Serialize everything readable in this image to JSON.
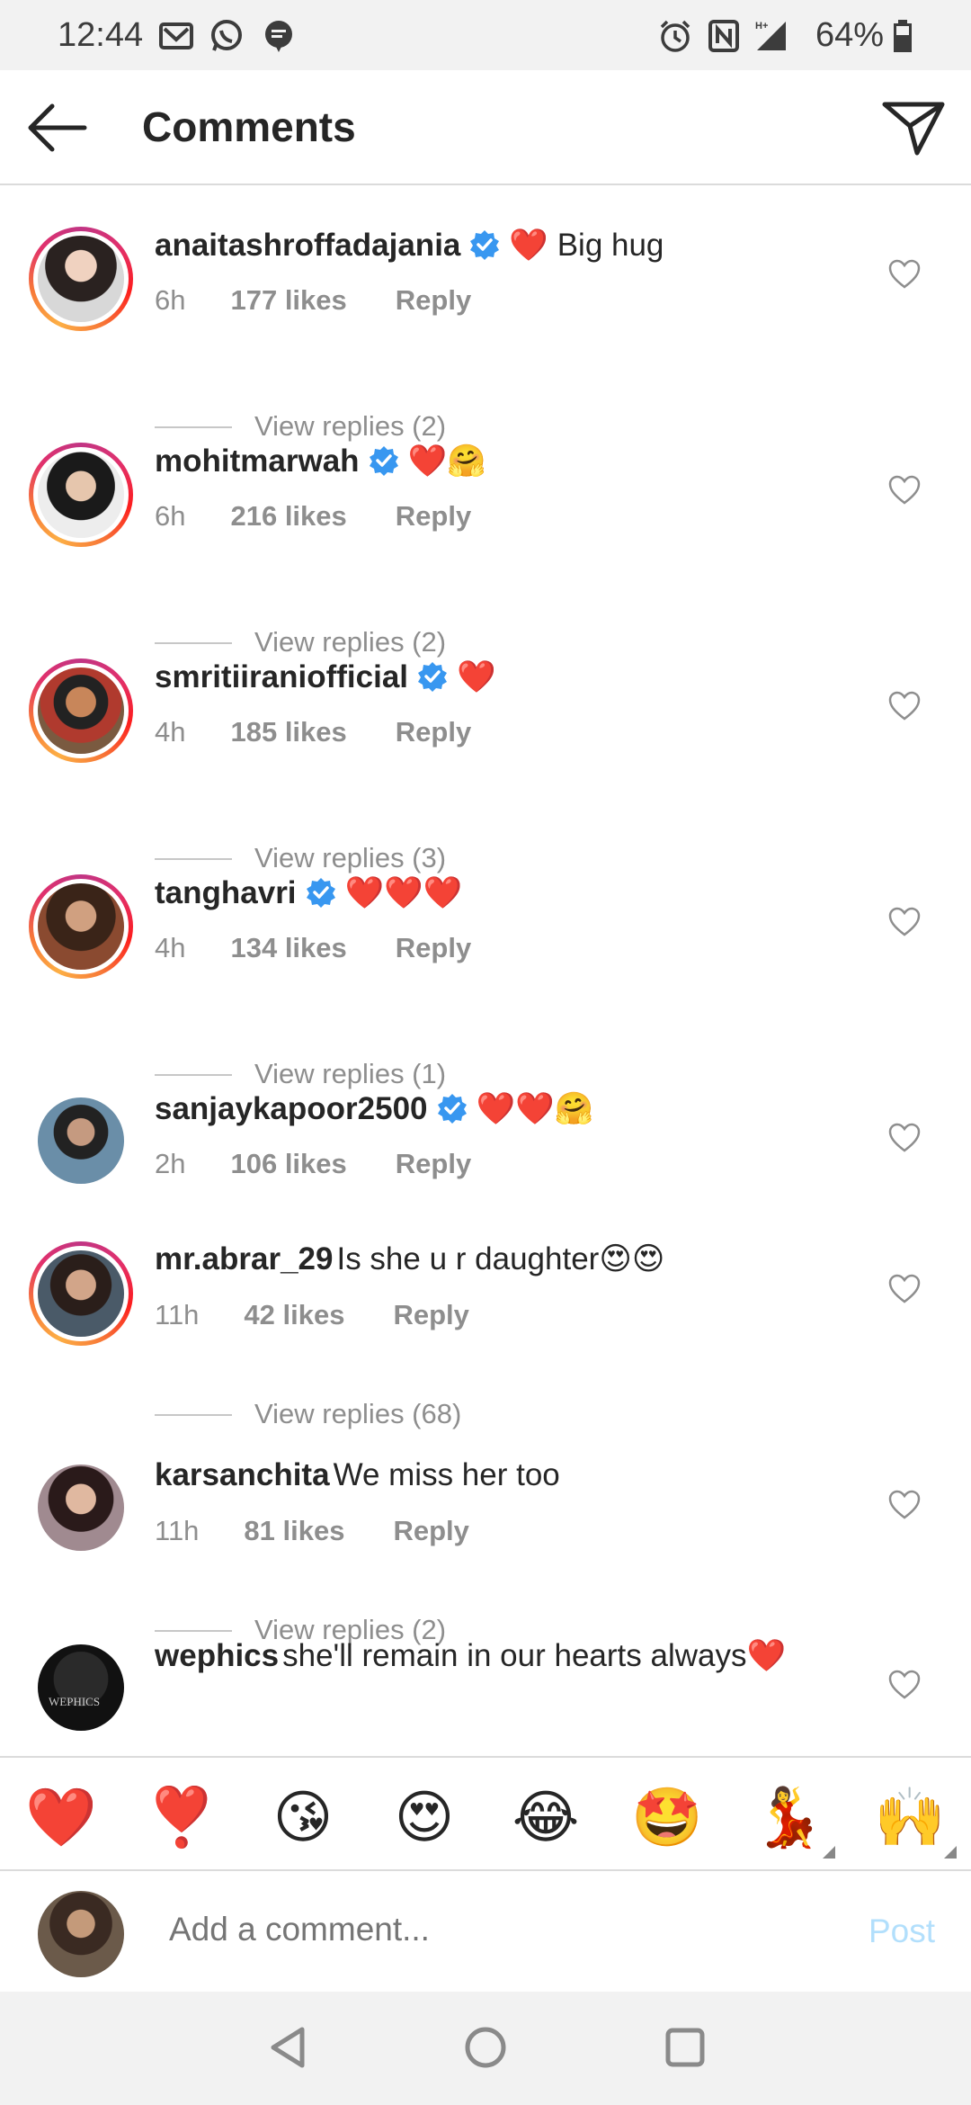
{
  "status_bar": {
    "time": "12:44",
    "battery": "64%",
    "icons": [
      "gmail-icon",
      "whatsapp-icon",
      "messages-icon",
      "alarm-icon",
      "nfc-icon",
      "signal-icon",
      "battery-icon"
    ]
  },
  "header": {
    "title": "Comments",
    "back_icon": "arrow-left-icon",
    "share_icon": "send-icon"
  },
  "comments": [
    {
      "user": "anaitashroffadajania",
      "verified": true,
      "text": "❤️ Big hug",
      "time": "6h",
      "likes": "177 likes",
      "reply": "Reply",
      "replies": "View replies (2)",
      "ring": true
    },
    {
      "user": "mohitmarwah",
      "verified": true,
      "text": "❤️🤗",
      "time": "6h",
      "likes": "216 likes",
      "reply": "Reply",
      "replies": "View replies (2)",
      "ring": true
    },
    {
      "user": "smritiiraniofficial",
      "verified": true,
      "text": "❤️",
      "time": "4h",
      "likes": "185 likes",
      "reply": "Reply",
      "replies": "View replies (3)",
      "ring": true
    },
    {
      "user": "tanghavri",
      "verified": true,
      "text": "❤️❤️❤️",
      "time": "4h",
      "likes": "134 likes",
      "reply": "Reply",
      "replies": "View replies (1)",
      "ring": true
    },
    {
      "user": "sanjaykapoor2500",
      "verified": true,
      "text": "❤️❤️🤗",
      "time": "2h",
      "likes": "106 likes",
      "reply": "Reply",
      "replies": "",
      "ring": false
    },
    {
      "user": "mr.abrar_29",
      "verified": false,
      "text": "Is she u r daughter😍😍",
      "time": "11h",
      "likes": "42 likes",
      "reply": "Reply",
      "replies": "View replies (68)",
      "ring": true
    },
    {
      "user": "karsanchita",
      "verified": false,
      "text": "We miss her too",
      "time": "11h",
      "likes": "81 likes",
      "reply": "Reply",
      "replies": "View replies (2)",
      "ring": false
    },
    {
      "user": "wephics",
      "verified": false,
      "text": "she'll remain in our hearts always❤️",
      "time": "",
      "likes": "",
      "reply": "",
      "replies": "",
      "ring": false,
      "avatar_text": "WEPHICS"
    }
  ],
  "reactions": [
    "❤️",
    "❣️",
    "😘",
    "😍",
    "😂",
    "🤩",
    "💃",
    "🙌"
  ],
  "compose": {
    "placeholder": "Add a comment...",
    "post_label": "Post"
  },
  "colors": {
    "accent": "#0095f6",
    "post_disabled": "#b2dffc",
    "verified": "#3897f0",
    "muted_text": "#8e8e8e",
    "story_ring": "#e1306c"
  },
  "nav": [
    "back-nav-icon",
    "home-nav-icon",
    "recents-nav-icon"
  ]
}
